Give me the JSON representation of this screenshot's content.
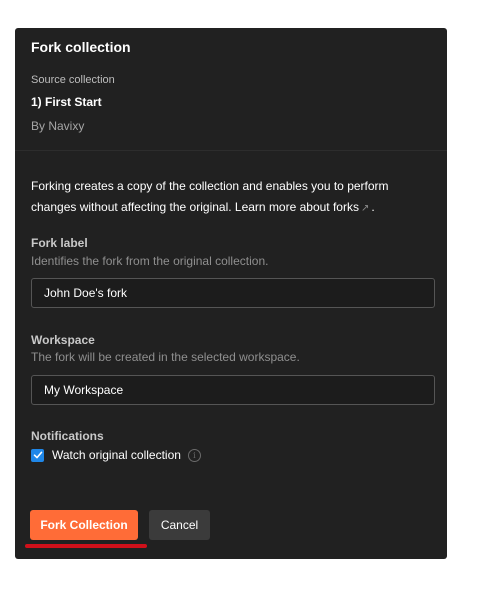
{
  "dialog": {
    "title": "Fork collection",
    "source_label": "Source collection",
    "source_name": "1) First Start",
    "source_author": "By Navixy",
    "description": "Forking creates a copy of the collection and enables you to perform changes without affecting the original. Learn more about forks",
    "description_link_icon": "external-link-icon",
    "description_end": "."
  },
  "fork_label": {
    "label": "Fork label",
    "hint": "Identifies the fork from the original collection.",
    "value": "John Doe's fork"
  },
  "workspace": {
    "label": "Workspace",
    "hint": "The fork will be created in the selected workspace.",
    "value": "My Workspace"
  },
  "notifications": {
    "label": "Notifications",
    "watch_label": "Watch original collection",
    "watch_checked": true
  },
  "actions": {
    "primary_label": "Fork Collection",
    "cancel_label": "Cancel"
  },
  "colors": {
    "dialog_bg": "#212121",
    "primary": "#ff6c37",
    "checkbox": "#1f87e8",
    "highlight": "#d0101a"
  }
}
